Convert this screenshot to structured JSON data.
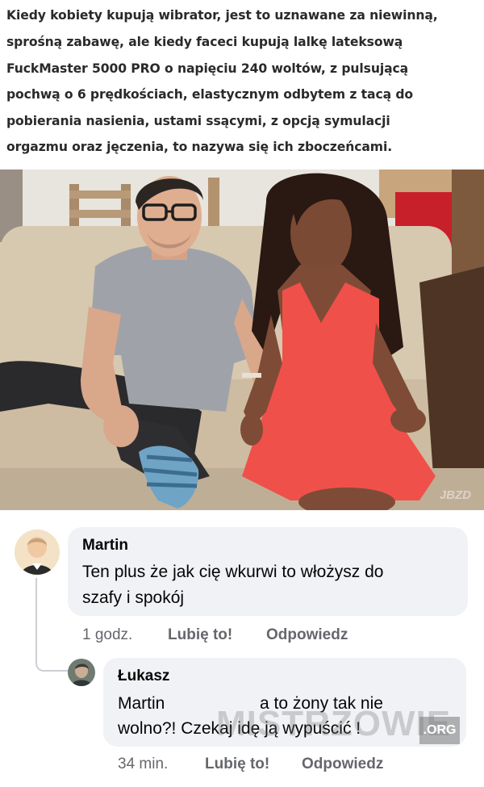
{
  "meme": {
    "caption_lines": [
      "Kiedy kobiety kupują wibrator, jest to uznawane za niewinną,",
      "sprośną zabawę, ale kiedy faceci kupują lalkę lateksową",
      "FuckMaster 5000 PRO o napięciu 240 woltów, z pulsującą",
      "pochwą o 6 prędkościach, elastycznym odbytem z tacą do",
      "pobierania nasienia, ustami ssącymi, z opcją symulacji",
      "orgazmu oraz jęczenia, to nazywa się ich zboczeńcami."
    ],
    "photo_mark": "JBZD"
  },
  "comments": [
    {
      "author": "Martin",
      "text_lines": [
        "Ten plus że jak cię wkurwi to włożysz do",
        "szafy i spokój"
      ],
      "time": "1 godz.",
      "like": "Lubię to!",
      "reply": "Odpowiedz"
    },
    {
      "author": "Łukasz",
      "mention": "Martin",
      "text_line1_rest": "a to żony tak nie",
      "text_line2": "wolno?! Czekaj idę ją wypuścić !",
      "time": "34 min.",
      "like": "Lubię to!",
      "reply": "Odpowiedz"
    }
  ],
  "watermark": {
    "text": "MISTRZOWIE",
    "badge": ".ORG"
  },
  "colors": {
    "bubble": "#f0f2f5",
    "secondary_text": "#65676b",
    "dress": "#f0504a"
  }
}
